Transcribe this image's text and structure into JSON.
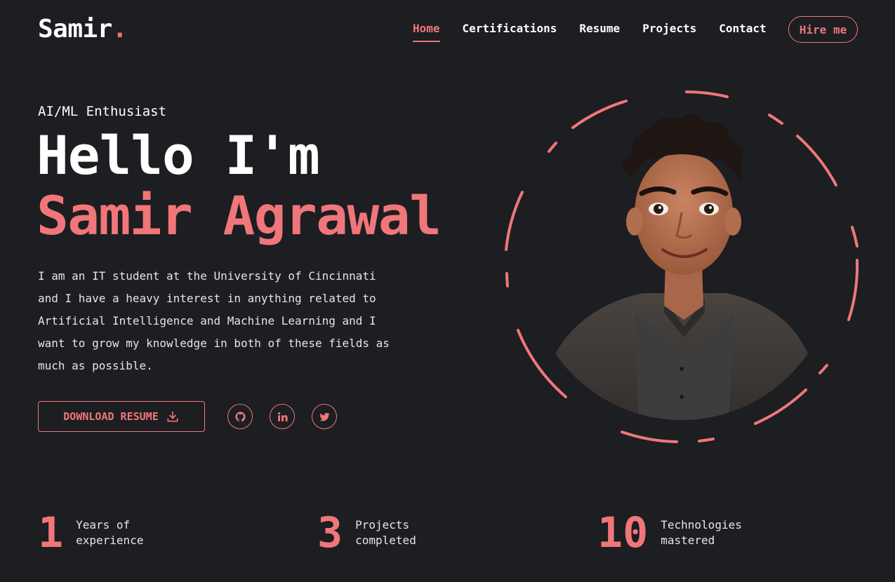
{
  "header": {
    "logo_text": "Samir",
    "logo_dot": ".",
    "nav": [
      {
        "label": "Home",
        "active": true
      },
      {
        "label": "Certifications",
        "active": false
      },
      {
        "label": "Resume",
        "active": false
      },
      {
        "label": "Projects",
        "active": false
      },
      {
        "label": "Contact",
        "active": false
      }
    ],
    "hire_label": "Hire me"
  },
  "hero": {
    "tagline": "AI/ML Enthusiast",
    "greeting": "Hello I'm",
    "name": "Samir Agrawal",
    "bio": "I am an IT student at the University of Cincinnati and I have a heavy interest in anything related to Artificial Intelligence and Machine Learning and I want to grow my knowledge in both of these fields as much as possible.",
    "download_label": "DOWNLOAD RESUME",
    "download_icon": "download-icon",
    "social": [
      {
        "name": "github",
        "icon": "github-icon"
      },
      {
        "name": "linkedin",
        "icon": "linkedin-icon"
      },
      {
        "name": "twitter",
        "icon": "twitter-icon"
      }
    ]
  },
  "stats": [
    {
      "value": "1",
      "label": "Years of experience"
    },
    {
      "value": "3",
      "label": "Projects completed"
    },
    {
      "value": "10",
      "label": "Technologies mastered"
    }
  ],
  "colors": {
    "background": "#1c1e21",
    "accent": "#f0767a",
    "text": "#ffffff"
  }
}
